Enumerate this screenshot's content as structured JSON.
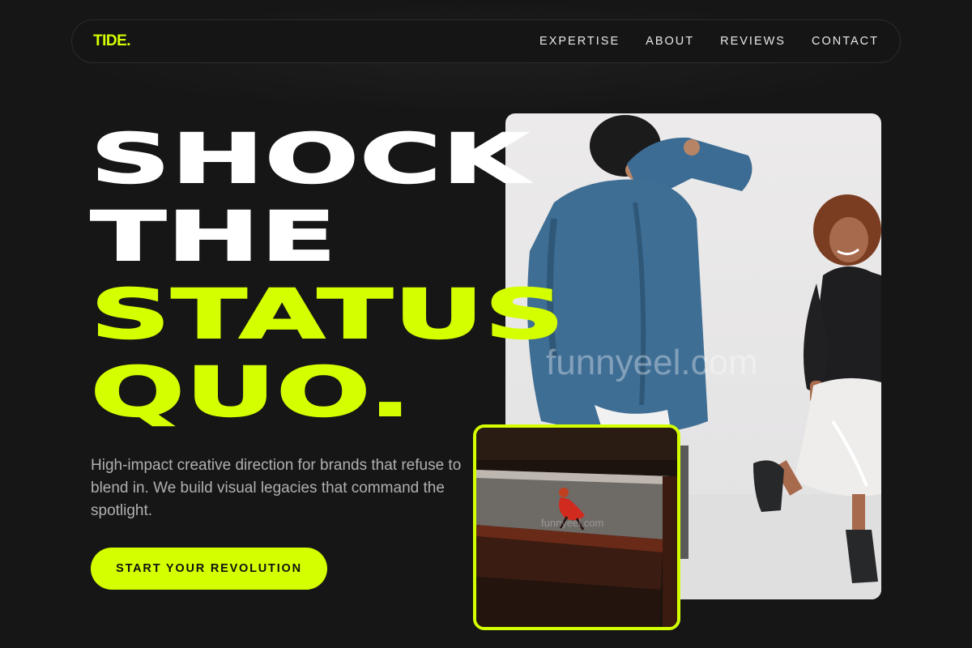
{
  "nav": {
    "logo": "TIDE.",
    "links": [
      "EXPERTISE",
      "ABOUT",
      "REVIEWS",
      "CONTACT"
    ]
  },
  "hero": {
    "headline": [
      "SHOCK",
      "THE",
      "STATUS",
      "QUO."
    ],
    "subtitle": "High-impact creative direction for brands that refuse to blend in. We build visual legacies that command the spotlight.",
    "cta_label": "START YOUR REVOLUTION",
    "watermark": "funnyeel.com"
  },
  "colors": {
    "background": "#161616",
    "accent": "#d4ff00",
    "text": "#ffffff",
    "muted": "#b0b0b0"
  }
}
